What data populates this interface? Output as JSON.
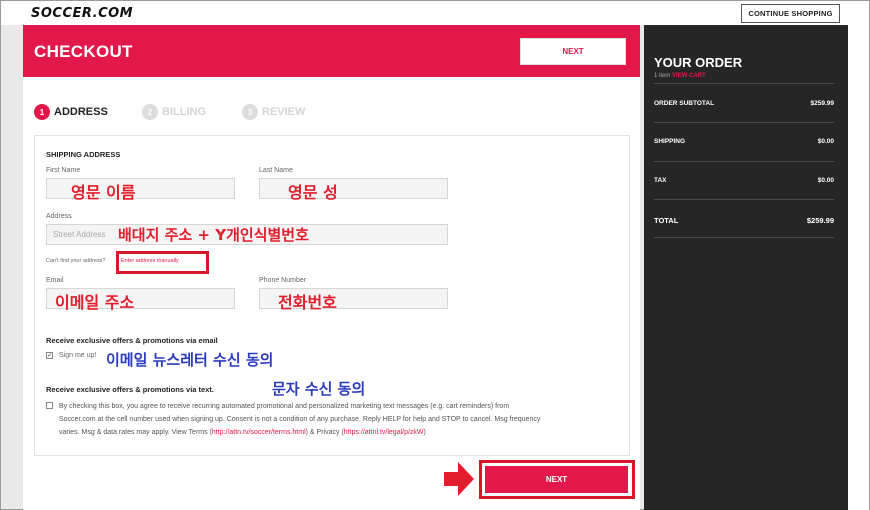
{
  "header": {
    "logo": "SOCCER.COM",
    "continue_shopping": "CONTINUE SHOPPING"
  },
  "checkout": {
    "title": "CHECKOUT",
    "next_label": "NEXT",
    "steps": [
      {
        "num": "1",
        "label": "ADDRESS"
      },
      {
        "num": "2",
        "label": "BILLING"
      },
      {
        "num": "3",
        "label": "REVIEW"
      }
    ],
    "shipping_title": "SHIPPING ADDRESS",
    "first_name_label": "First Name",
    "last_name_label": "Last Name",
    "address_label": "Address",
    "address_placeholder": "Street Address",
    "cant_find": "Can't find your address?",
    "enter_manually": "Enter address manually",
    "email_label": "Email",
    "phone_label": "Phone Number",
    "offers_email_title": "Receive exclusive offers & promotions via email",
    "sign_me_up": "Sign me up!",
    "offers_text_title": "Receive exclusive offers & promotions via text.",
    "sms_consent_1": "By checking this box, you agree to receive recurring automated promotional and personalized marketing text messages (e.g. cart reminders) from",
    "sms_consent_2": "Soccer.com at the cell number used when signing up. Consent is not a condition of any purchase. Reply HELP for help and STOP to cancel. Msg frequency",
    "sms_consent_3a": "varies. Msg & data rates may apply. View Terms (",
    "terms_link": "http://attn.tv/soccer/terms.html",
    "sms_consent_3b": ") & Privacy (",
    "privacy_link": "https://attnl.tv/legal/p/zkW",
    "sms_consent_3c": ")",
    "bottom_next": "NEXT"
  },
  "annotations": {
    "first_name": "영문 이름",
    "last_name": "영문 성",
    "address": "배대지 주소 + Y개인식별번호",
    "email": "이메일 주소",
    "phone": "전화번호",
    "newsletter": "이메일 뉴스레터 수신 동의",
    "sms": "문자 수신 동의"
  },
  "order": {
    "title": "YOUR ORDER",
    "items_count": "1 item",
    "view_cart": "VIEW CART",
    "rows": [
      {
        "label": "ORDER SUBTOTAL",
        "value": "$259.99"
      },
      {
        "label": "SHIPPING",
        "value": "$0.00"
      },
      {
        "label": "TAX",
        "value": "$0.00"
      }
    ],
    "total_label": "TOTAL",
    "total_value": "$259.99"
  },
  "colors": {
    "accent": "#e3184a",
    "sidebar": "#262626",
    "annotation_red": "#e21e2c",
    "annotation_blue": "#2b3bbd"
  }
}
